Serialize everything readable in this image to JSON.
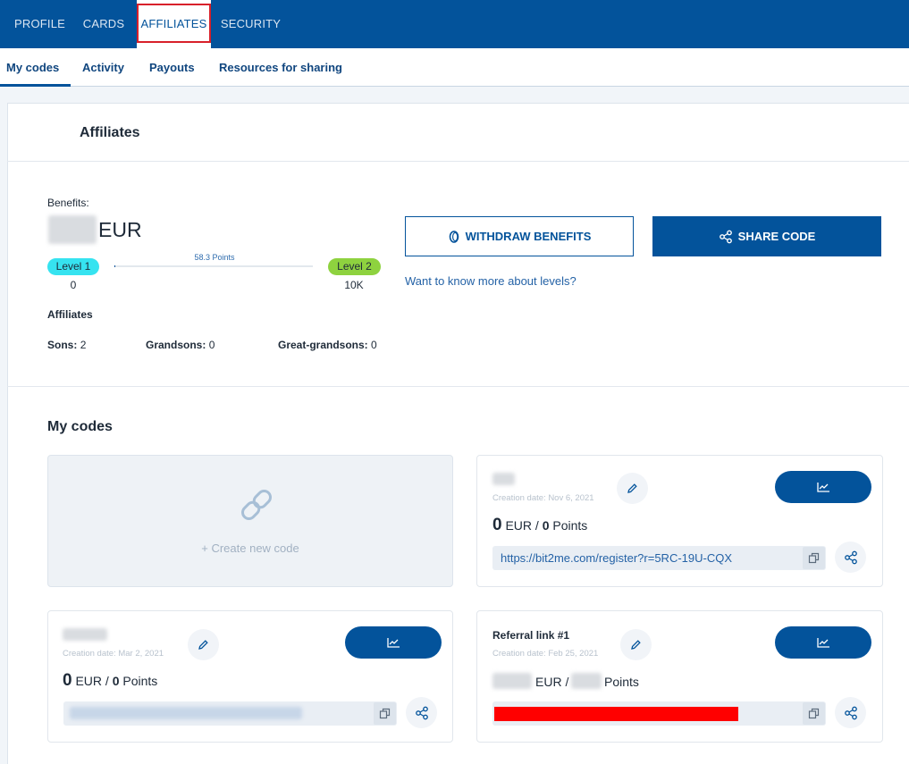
{
  "topnav": {
    "tabs": [
      {
        "label": "PROFILE"
      },
      {
        "label": "CARDS"
      },
      {
        "label": "AFFILIATES",
        "active": true
      },
      {
        "label": "SECURITY"
      }
    ]
  },
  "subnav": {
    "tabs": [
      {
        "label": "My codes",
        "active": true
      },
      {
        "label": "Activity"
      },
      {
        "label": "Payouts"
      },
      {
        "label": "Resources for sharing"
      }
    ]
  },
  "page": {
    "title": "Affiliates"
  },
  "benefits": {
    "label": "Benefits:",
    "currency": "EUR",
    "level_from": {
      "label": "Level 1",
      "value": "0",
      "color": "#36e3f0"
    },
    "level_to": {
      "label": "Level 2",
      "value": "10K",
      "color": "#8ed23f"
    },
    "points_label": "58.3 Points",
    "progress_fraction": 0.006,
    "withdraw_label": "WITHDRAW BENEFITS",
    "share_label": "SHARE CODE",
    "levels_link": "Want to know more about levels?"
  },
  "affiliates": {
    "heading": "Affiliates",
    "sons_label": "Sons:",
    "sons_value": "2",
    "grandsons_label": "Grandsons:",
    "grandsons_value": "0",
    "great_label": "Great-grandsons:",
    "great_value": "0"
  },
  "codes": {
    "title": "My codes",
    "create_label": "+  Create new code",
    "items": [
      {
        "date": "Creation date: Nov 6, 2021",
        "amount": "0",
        "currency": "EUR /",
        "points": "0",
        "points_label": "Points",
        "link": "https://bit2me.com/register?r=5RC-19U-CQX"
      },
      {
        "date": "Creation date: Mar 2, 2021",
        "amount": "0",
        "currency": "EUR /",
        "points": "0",
        "points_label": "Points"
      },
      {
        "name": "Referral link #1",
        "date": "Creation date: Feb 25, 2021",
        "currency": "EUR /",
        "points_label": "Points"
      }
    ]
  },
  "colors": {
    "brand": "#03539b",
    "highlight_outline": "#d8202a",
    "redaction": "#ff0000"
  }
}
